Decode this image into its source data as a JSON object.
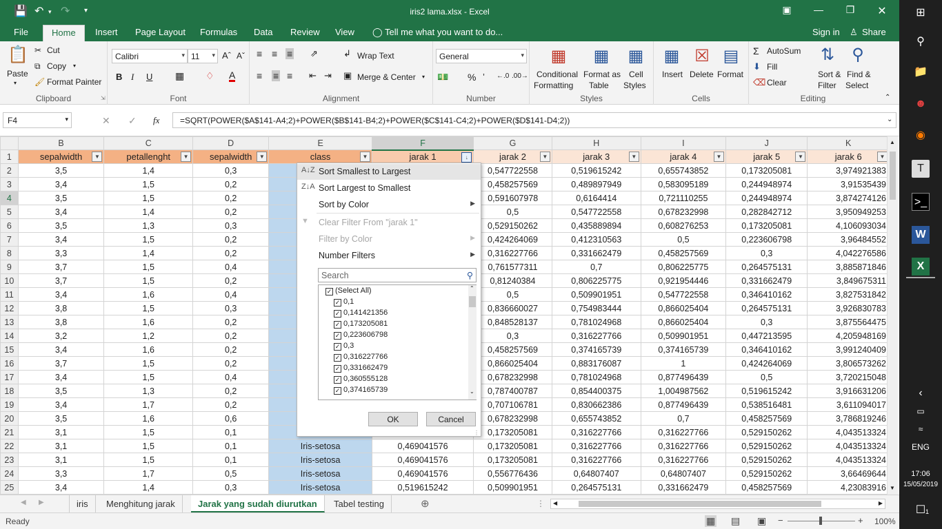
{
  "window": {
    "title": "iris2 lama.xlsx - Excel"
  },
  "menu": {
    "file": "File",
    "home": "Home",
    "insert": "Insert",
    "page_layout": "Page Layout",
    "formulas": "Formulas",
    "data": "Data",
    "review": "Review",
    "view": "View",
    "tell_me": "Tell me what you want to do...",
    "sign_in": "Sign in",
    "share": "Share"
  },
  "ribbon": {
    "clipboard": {
      "label": "Clipboard",
      "paste": "Paste",
      "cut": "Cut",
      "copy": "Copy",
      "format_painter": "Format Painter"
    },
    "font": {
      "label": "Font",
      "name": "Calibri",
      "size": "11"
    },
    "alignment": {
      "label": "Alignment",
      "wrap_text": "Wrap Text",
      "merge_center": "Merge & Center"
    },
    "number": {
      "label": "Number",
      "format": "General"
    },
    "styles": {
      "label": "Styles",
      "conditional_formatting_1": "Conditional",
      "conditional_formatting_2": "Formatting",
      "format_as_table_1": "Format as",
      "format_as_table_2": "Table",
      "cell_styles_1": "Cell",
      "cell_styles_2": "Styles"
    },
    "cells": {
      "label": "Cells",
      "insert": "Insert",
      "delete": "Delete",
      "format": "Format"
    },
    "editing": {
      "label": "Editing",
      "autosum": "AutoSum",
      "fill": "Fill",
      "clear": "Clear",
      "sort_filter_1": "Sort &",
      "sort_filter_2": "Filter",
      "find_select_1": "Find &",
      "find_select_2": "Select"
    }
  },
  "formula_bar": {
    "name_box": "F4",
    "fx": "fx",
    "formula": "=SQRT(POWER($A$141-A4;2)+POWER($B$141-B4;2)+POWER($C$141-C4;2)+POWER($D$141-D4;2))"
  },
  "columns": [
    "B",
    "C",
    "D",
    "E",
    "F",
    "G",
    "H",
    "I",
    "J",
    "K"
  ],
  "headers": [
    "sepalwidth",
    "petallenght",
    "sepalwidth",
    "class",
    "jarak 1",
    "jarak 2",
    "jarak 3",
    "jarak 4",
    "jarak 5",
    "jarak 6"
  ],
  "rows": [
    {
      "n": "2",
      "v": [
        "3,5",
        "1,4",
        "0,3",
        "",
        "",
        "0,547722558",
        "0,519615242",
        "0,655743852",
        "0,173205081",
        "3,974921383"
      ]
    },
    {
      "n": "3",
      "v": [
        "3,4",
        "1,5",
        "0,2",
        "",
        "",
        "0,458257569",
        "0,489897949",
        "0,583095189",
        "0,244948974",
        "3,91535439"
      ]
    },
    {
      "n": "4",
      "v": [
        "3,5",
        "1,5",
        "0,2",
        "",
        "",
        "0,591607978",
        "0,6164414",
        "0,721110255",
        "0,244948974",
        "3,874274126"
      ]
    },
    {
      "n": "5",
      "v": [
        "3,4",
        "1,4",
        "0,2",
        "",
        "",
        "0,5",
        "0,547722558",
        "0,678232998",
        "0,282842712",
        "3,950949253"
      ]
    },
    {
      "n": "6",
      "v": [
        "3,5",
        "1,3",
        "0,3",
        "",
        "",
        "0,529150262",
        "0,435889894",
        "0,608276253",
        "0,173205081",
        "4,106093034"
      ]
    },
    {
      "n": "7",
      "v": [
        "3,4",
        "1,5",
        "0,2",
        "",
        "",
        "0,424264069",
        "0,412310563",
        "0,5",
        "0,223606798",
        "3,96484552"
      ]
    },
    {
      "n": "8",
      "v": [
        "3,3",
        "1,4",
        "0,2",
        "",
        "",
        "0,316227766",
        "0,331662479",
        "0,458257569",
        "0,3",
        "4,042276586"
      ]
    },
    {
      "n": "9",
      "v": [
        "3,7",
        "1,5",
        "0,4",
        "",
        "",
        "0,761577311",
        "0,7",
        "0,806225775",
        "0,264575131",
        "3,885871846"
      ]
    },
    {
      "n": "10",
      "v": [
        "3,7",
        "1,5",
        "0,2",
        "",
        "",
        "0,81240384",
        "0,806225775",
        "0,921954446",
        "0,331662479",
        "3,849675311"
      ]
    },
    {
      "n": "11",
      "v": [
        "3,4",
        "1,6",
        "0,4",
        "",
        "",
        "0,5",
        "0,509901951",
        "0,547722558",
        "0,346410162",
        "3,827531842"
      ]
    },
    {
      "n": "12",
      "v": [
        "3,8",
        "1,5",
        "0,3",
        "",
        "",
        "0,836660027",
        "0,754983444",
        "0,866025404",
        "0,264575131",
        "3,926830783"
      ]
    },
    {
      "n": "13",
      "v": [
        "3,8",
        "1,6",
        "0,2",
        "",
        "",
        "0,848528137",
        "0,781024968",
        "0,866025404",
        "0,3",
        "3,875564475"
      ]
    },
    {
      "n": "14",
      "v": [
        "3,2",
        "1,2",
        "0,2",
        "",
        "",
        "0,3",
        "0,316227766",
        "0,509901951",
        "0,447213595",
        "4,205948169"
      ]
    },
    {
      "n": "15",
      "v": [
        "3,4",
        "1,6",
        "0,2",
        "",
        "",
        "0,458257569",
        "0,374165739",
        "0,374165739",
        "0,346410162",
        "3,991240409"
      ]
    },
    {
      "n": "16",
      "v": [
        "3,7",
        "1,5",
        "0,2",
        "",
        "",
        "0,866025404",
        "0,883176087",
        "1",
        "0,424264069",
        "3,806573262"
      ]
    },
    {
      "n": "17",
      "v": [
        "3,4",
        "1,5",
        "0,4",
        "",
        "",
        "0,678232998",
        "0,781024968",
        "0,877496439",
        "0,5",
        "3,720215048"
      ]
    },
    {
      "n": "18",
      "v": [
        "3,5",
        "1,3",
        "0,2",
        "",
        "",
        "0,787400787",
        "0,854400375",
        "1,004987562",
        "0,519615242",
        "3,916631206"
      ]
    },
    {
      "n": "19",
      "v": [
        "3,4",
        "1,7",
        "0,2",
        "",
        "",
        "0,707106781",
        "0,830662386",
        "0,877496439",
        "0,538516481",
        "3,611094017"
      ]
    },
    {
      "n": "20",
      "v": [
        "3,5",
        "1,6",
        "0,6",
        "",
        "",
        "0,678232998",
        "0,655743852",
        "0,7",
        "0,458257569",
        "3,786819246"
      ]
    },
    {
      "n": "21",
      "v": [
        "3,1",
        "1,5",
        "0,1",
        "",
        "",
        "0,173205081",
        "0,316227766",
        "0,316227766",
        "0,529150262",
        "4,043513324"
      ]
    },
    {
      "n": "22",
      "v": [
        "3,1",
        "1,5",
        "0,1",
        "Iris-setosa",
        "0,469041576",
        "0,173205081",
        "0,316227766",
        "0,316227766",
        "0,529150262",
        "4,043513324"
      ]
    },
    {
      "n": "23",
      "v": [
        "3,1",
        "1,5",
        "0,1",
        "Iris-setosa",
        "0,469041576",
        "0,173205081",
        "0,316227766",
        "0,316227766",
        "0,529150262",
        "4,043513324"
      ]
    },
    {
      "n": "24",
      "v": [
        "3,3",
        "1,7",
        "0,5",
        "Iris-setosa",
        "0,469041576",
        "0,556776436",
        "0,64807407",
        "0,64807407",
        "0,529150262",
        "3,66469644"
      ]
    },
    {
      "n": "25",
      "v": [
        "3,4",
        "1,4",
        "0,3",
        "Iris-setosa",
        "0,519615242",
        "0,509901951",
        "0,264575131",
        "0,331662479",
        "0,458257569",
        "4,23083916"
      ]
    }
  ],
  "filter_menu": {
    "sort_asc": "Sort Smallest to Largest",
    "sort_desc": "Sort Largest to Smallest",
    "sort_color": "Sort by Color",
    "clear_filter": "Clear Filter From \"jarak 1\"",
    "filter_color": "Filter by Color",
    "number_filters": "Number Filters",
    "search_placeholder": "Search",
    "items": [
      "(Select All)",
      "0,1",
      "0,141421356",
      "0,173205081",
      "0,223606798",
      "0,3",
      "0,316227766",
      "0,331662479",
      "0,360555128",
      "0,374165739"
    ],
    "ok": "OK",
    "cancel": "Cancel"
  },
  "sheets": [
    "iris",
    "Menghitung jarak",
    "Jarak yang sudah diurutkan",
    "Tabel testing"
  ],
  "status": {
    "ready": "Ready",
    "zoom": "100%"
  },
  "taskbar": {
    "lang": "ENG",
    "time": "17:06",
    "date": "15/05/2019",
    "notif_count": "1"
  }
}
